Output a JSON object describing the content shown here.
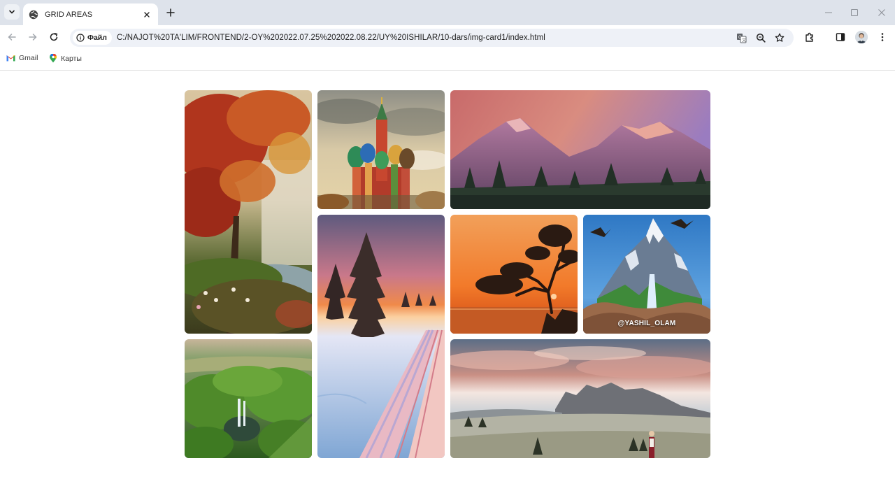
{
  "browser": {
    "tab": {
      "title": "GRID AREAS"
    },
    "omnibox": {
      "site_chip": "Файл",
      "url": "C:/NAJOT%20TA'LIM/FRONTEND/2-OY%202022.07.25%202022.08.22/UY%20ISHILAR/10-dars/img-card1/index.html"
    },
    "bookmarks": [
      {
        "label": "Gmail",
        "icon": "gmail-icon"
      },
      {
        "label": "Карты",
        "icon": "maps-pin-icon"
      }
    ],
    "icons": [
      "tab-search-icon",
      "globe-icon",
      "close-icon",
      "plus-icon",
      "minimize-icon",
      "maximize-icon",
      "back-arrow-icon",
      "forward-arrow-icon",
      "reload-icon",
      "info-icon",
      "translate-icon",
      "zoom-icon",
      "star-icon",
      "extensions-icon",
      "side-panel-icon",
      "avatar",
      "more-vertical-icon"
    ]
  },
  "gallery": {
    "cards": [
      {
        "area": "a",
        "subject": "autumn-forest"
      },
      {
        "area": "b",
        "subject": "cathedral"
      },
      {
        "area": "c",
        "subject": "pink-mountains"
      },
      {
        "area": "d",
        "subject": "snowy-sunset-road"
      },
      {
        "area": "e",
        "subject": "tree-sunset"
      },
      {
        "area": "f",
        "subject": "mountain-in-hands",
        "watermark": "@YASHIL_OLAM"
      },
      {
        "area": "g",
        "subject": "jungle-waterfall"
      },
      {
        "area": "h",
        "subject": "meadow-dolomites"
      }
    ]
  },
  "colors": {
    "tabstrip": "#dee3eb",
    "omnibox": "#eef1f7",
    "page": "#ffffff"
  }
}
